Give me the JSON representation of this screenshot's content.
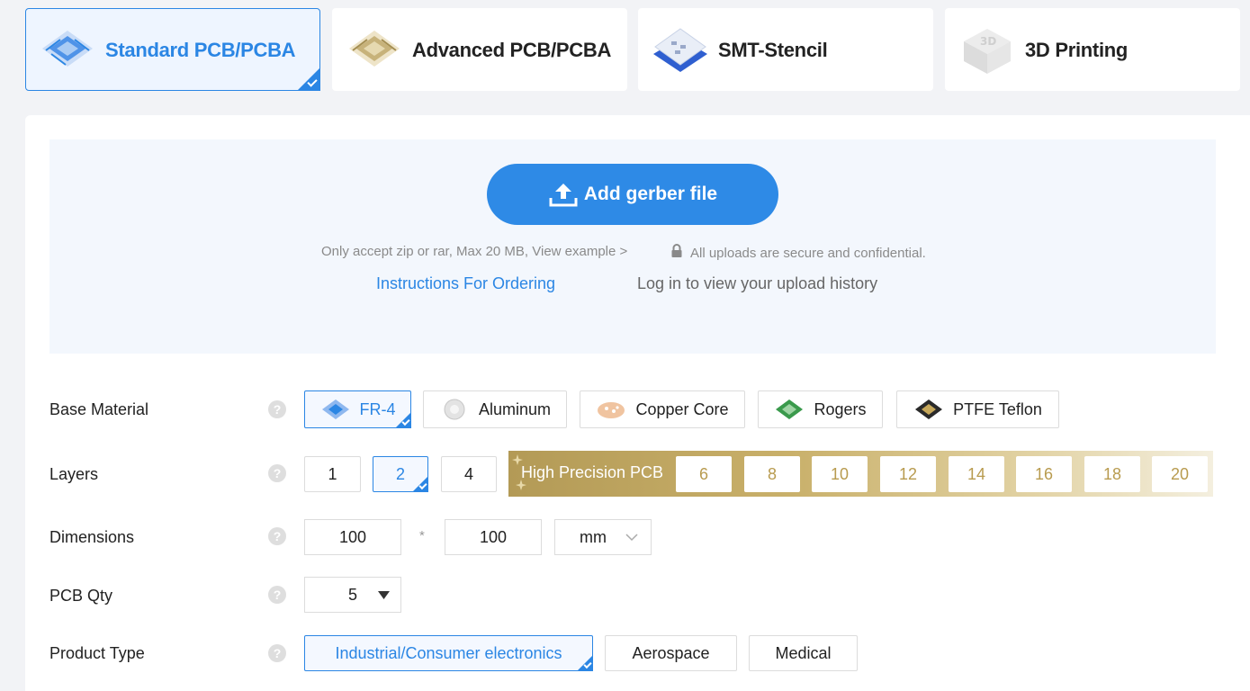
{
  "tabs": [
    {
      "label": "Standard PCB/PCBA",
      "icon": "standard-pcb-icon",
      "active": true
    },
    {
      "label": "Advanced PCB/PCBA",
      "icon": "advanced-pcb-icon",
      "active": false
    },
    {
      "label": "SMT-Stencil",
      "icon": "smt-stencil-icon",
      "active": false
    },
    {
      "label": "3D Printing",
      "icon": "3d-printing-icon",
      "active": false
    }
  ],
  "upload": {
    "button_label": "Add gerber file",
    "accept_note": "Only accept zip or rar, Max 20 MB, View example >",
    "secure_note": "All uploads are secure and confidential.",
    "instructions_link": "Instructions For Ordering",
    "history_link": "Log in to view your upload history"
  },
  "form": {
    "help_glyph": "?",
    "base_material": {
      "label": "Base Material",
      "options": [
        "FR-4",
        "Aluminum",
        "Copper Core",
        "Rogers",
        "PTFE Teflon"
      ],
      "selected": "FR-4"
    },
    "layers": {
      "label": "Layers",
      "options": [
        "1",
        "2",
        "4"
      ],
      "selected": "2",
      "high_precision_label": "High Precision PCB",
      "high_precision_options": [
        "6",
        "8",
        "10",
        "12",
        "14",
        "16",
        "18",
        "20"
      ]
    },
    "dimensions": {
      "label": "Dimensions",
      "width": "100",
      "separator": "*",
      "height": "100",
      "unit": "mm"
    },
    "pcb_qty": {
      "label": "PCB Qty",
      "value": "5"
    },
    "product_type": {
      "label": "Product Type",
      "options": [
        "Industrial/Consumer electronics",
        "Aerospace",
        "Medical"
      ],
      "selected": "Industrial/Consumer electronics"
    }
  },
  "colors": {
    "accent": "#2b86e4",
    "upload_button": "#2e8ae6",
    "gold": "#b89b4f"
  }
}
